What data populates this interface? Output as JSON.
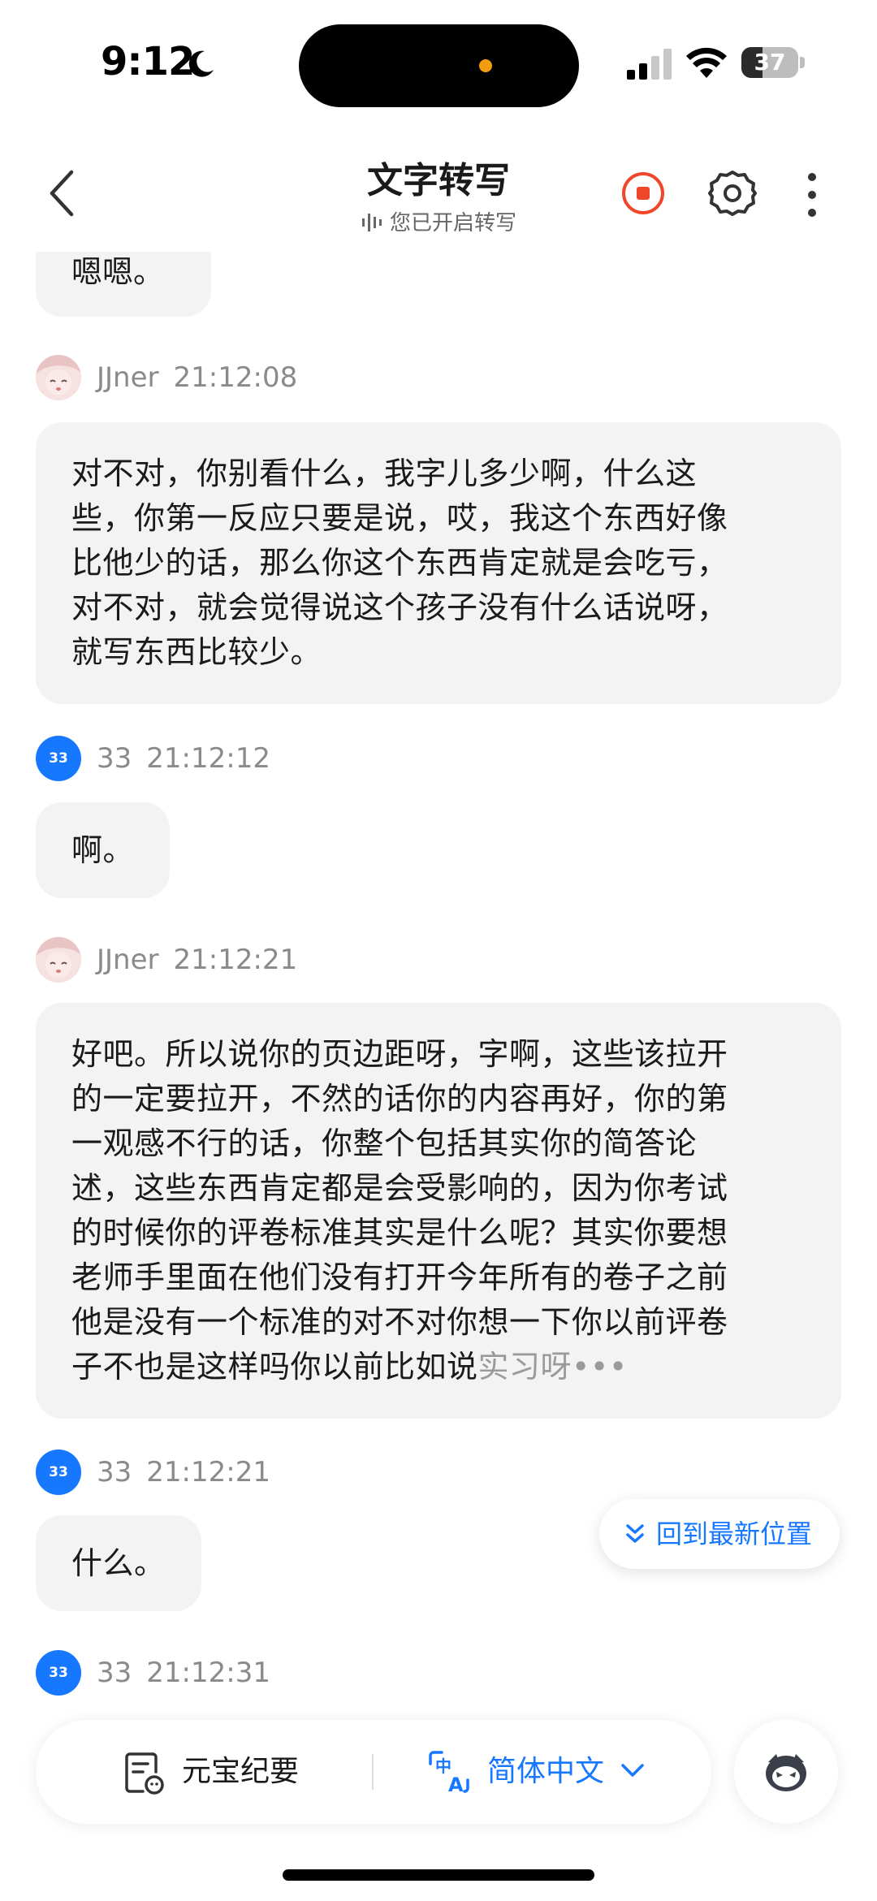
{
  "status_bar": {
    "time": "9:12",
    "battery": "37",
    "battery_level_percent": 37
  },
  "header": {
    "title": "文字转写",
    "subtitle": "您已开启转写"
  },
  "messages": [
    {
      "id": "m0",
      "text": "嗯嗯。"
    },
    {
      "id": "m1",
      "speaker": "JJner",
      "time": "21:12:08",
      "lines": [
        "对不对，你别看什么，我字儿多少啊，什么这",
        "些，你第一反应只要是说，哎，我这个东西好像",
        "比他少的话，那么你这个东西肯定就是会吃亏，",
        "对不对，就会觉得说这个孩子没有什么话说呀，",
        "就写东西比较少。"
      ]
    },
    {
      "id": "m2",
      "speaker": "33",
      "time": "21:12:12",
      "text": "啊。"
    },
    {
      "id": "m3",
      "speaker": "JJner",
      "time": "21:12:21",
      "lines": [
        "好吧。所以说你的页边距呀，字啊，这些该拉开",
        "的一定要拉开，不然的话你的内容再好，你的第",
        "一观感不行的话，你整个包括其实你的简答论",
        "述，这些东西肯定都是会受影响的，因为你考试",
        "的时候你的评卷标准其实是什么呢？其实你要想",
        "老师手里面在他们没有打开今年所有的卷子之前",
        "他是没有一个标准的对不对你想一下你以前评卷"
      ],
      "last_line": "子不也是这样吗你以前比如说",
      "last_line_pending": "实习呀•••"
    },
    {
      "id": "m4",
      "speaker": "33",
      "time": "21:12:21",
      "text": "什么。"
    },
    {
      "id": "m5",
      "speaker": "33",
      "time": "21:12:31"
    }
  ],
  "avatar_label": "33",
  "jump_latest": "回到最新位置",
  "bottom_bar": {
    "summary_label": "元宝纪要",
    "language_label": "简体中文"
  },
  "colors": {
    "accent": "#1677ff",
    "record_stop": "#f0472a",
    "bubble_bg": "#f3f3f3",
    "meta_text": "#8a8a8a"
  },
  "icons": [
    "moon-icon",
    "signal-icon",
    "wifi-icon",
    "back-icon",
    "sound-wave-icon",
    "stop-record-icon",
    "gear-icon",
    "more-icon",
    "double-chevron-down-icon",
    "summary-doc-icon",
    "translate-icon",
    "chevron-down-icon",
    "assistant-icon"
  ]
}
